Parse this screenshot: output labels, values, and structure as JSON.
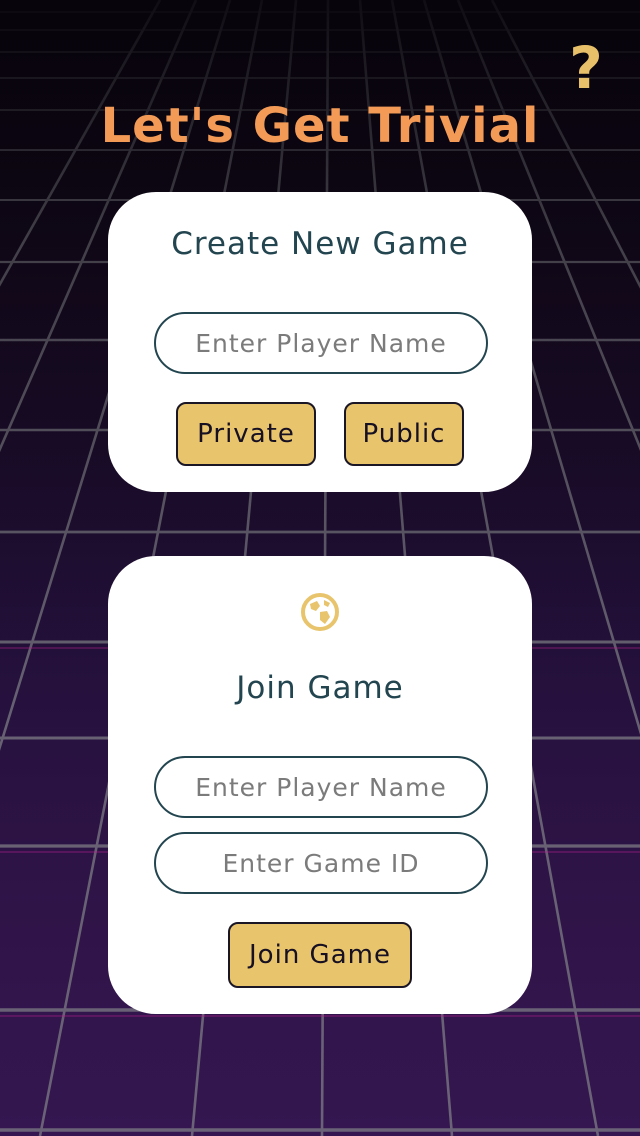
{
  "app": {
    "title": "Let's Get Trivial",
    "help_label": "?"
  },
  "create_game": {
    "heading": "Create New Game",
    "player_name": {
      "value": "",
      "placeholder": "Enter Player Name"
    },
    "private_label": "Private",
    "public_label": "Public"
  },
  "join_game": {
    "icon": "globe-icon",
    "heading": "Join Game",
    "player_name": {
      "value": "",
      "placeholder": "Enter Player Name"
    },
    "game_id": {
      "value": "",
      "placeholder": "Enter Game ID"
    },
    "join_label": "Join Game"
  },
  "colors": {
    "title": "#f29a56",
    "accent_gold": "#e8c46c",
    "heading": "#234550",
    "card": "#ffffff",
    "background": "#23103a",
    "grid_line": "#8a8a8a"
  }
}
